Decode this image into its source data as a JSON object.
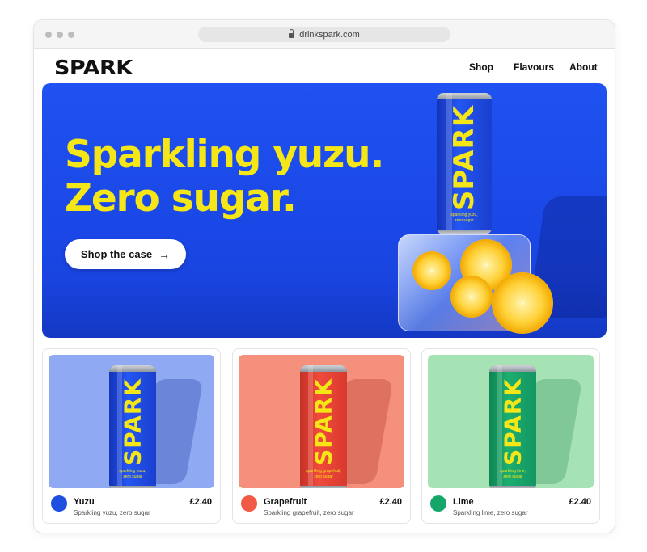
{
  "browser": {
    "url": "drinkspark.com"
  },
  "nav": {
    "logo": "SPARK",
    "links": [
      "Shop",
      "Flavours",
      "About"
    ]
  },
  "hero": {
    "headline_line1": "Sparkling yuzu.",
    "headline_line2": "Zero sugar.",
    "cta_label": "Shop the case",
    "can": {
      "brand": "SPARK",
      "sub_line1": "sparkling yuzu,",
      "sub_line2": "zero sugar"
    }
  },
  "products": [
    {
      "name": "Yuzu",
      "description": "Sparkling yuzu, zero sugar",
      "price": "£2.40",
      "can_sub_line1": "sparkling yuzu,",
      "can_sub_line2": "zero sugar",
      "color": "#1f4fe0",
      "bg": "#8fa9f2"
    },
    {
      "name": "Grapefruit",
      "description": "Sparkling grapefruit, zero sugar",
      "price": "£2.40",
      "can_sub_line1": "sparkling grapefruit,",
      "can_sub_line2": "zero sugar",
      "color": "#f15a45",
      "bg": "#f4907c"
    },
    {
      "name": "Lime",
      "description": "Sparkling lime, zero sugar",
      "price": "£2.40",
      "can_sub_line1": "sparkling lime,",
      "can_sub_line2": "zero sugar",
      "color": "#17a66a",
      "bg": "#a6e3b4"
    }
  ],
  "colors": {
    "brand_yellow": "#f5e617",
    "hero_blue": "#1f52f0"
  }
}
